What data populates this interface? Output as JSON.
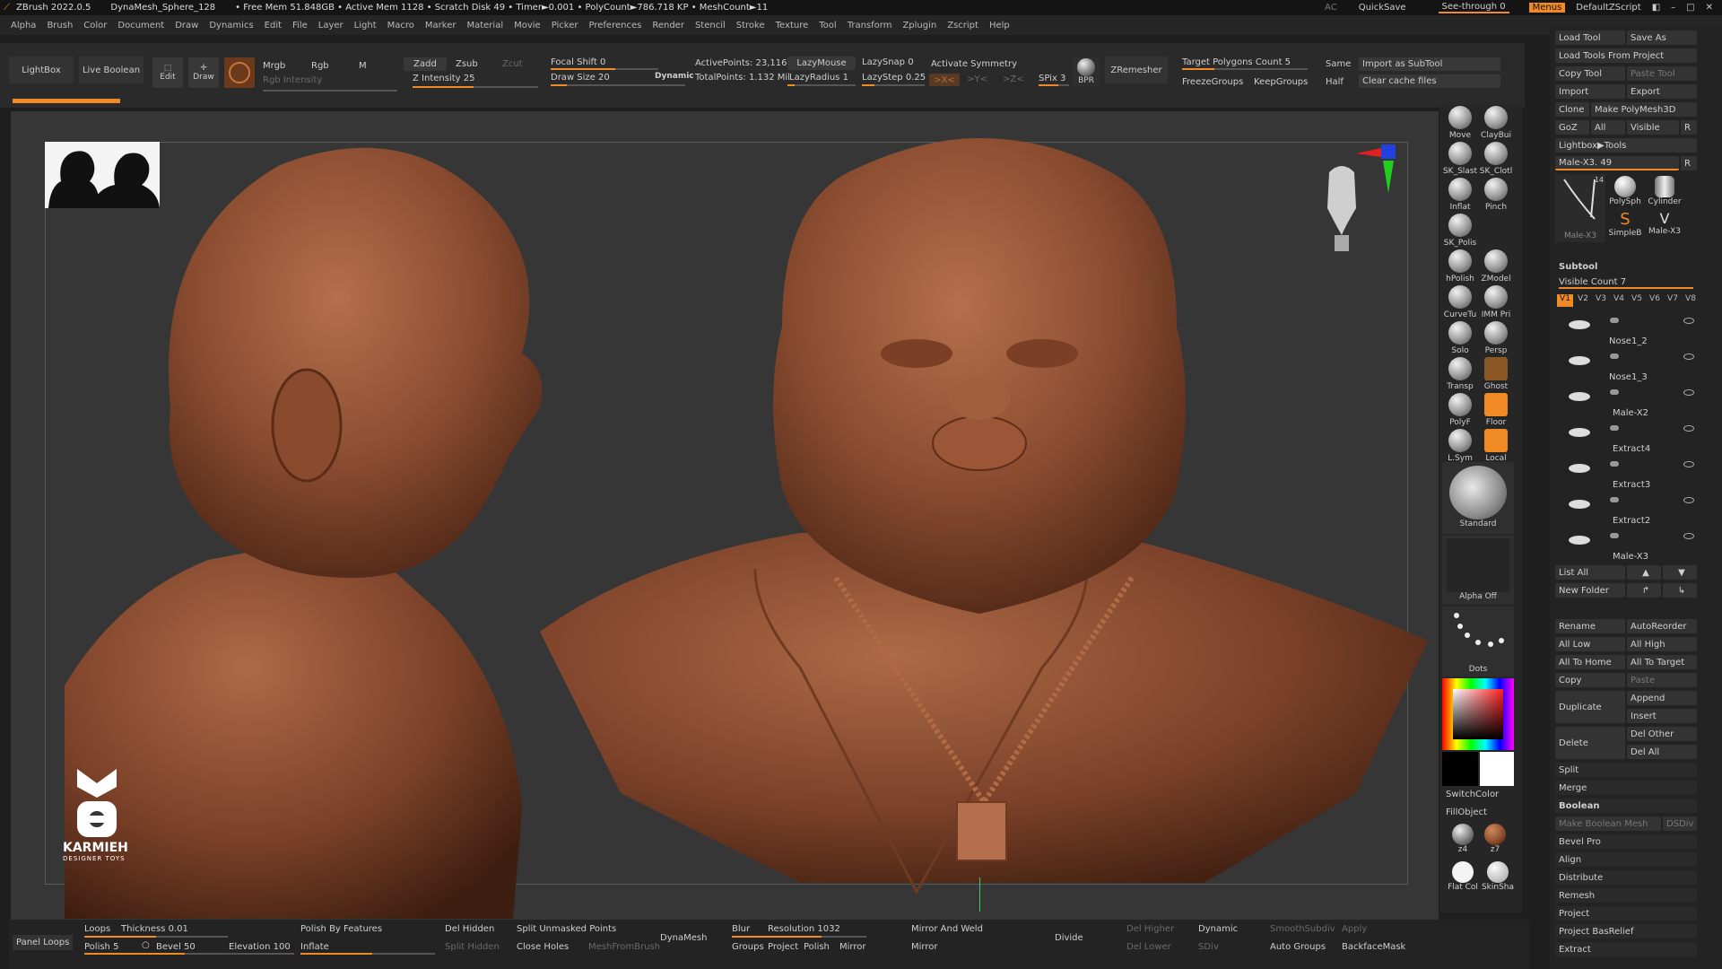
{
  "title_bar": {
    "app": "ZBrush 2022.0.5",
    "doc": "DynaMesh_Sphere_128",
    "stats": "• Free Mem 51.848GB • Active Mem 1128 • Scratch Disk 49 • Timer►0.001 • PolyCount►786.718 KP • MeshCount►11",
    "ac": "AC",
    "quicksave": "QuickSave",
    "see_through": "See-through  0",
    "menus": "Menus",
    "script": "DefaultZScript"
  },
  "menu": [
    "Alpha",
    "Brush",
    "Color",
    "Document",
    "Draw",
    "Dynamics",
    "Edit",
    "File",
    "Layer",
    "Light",
    "Macro",
    "Marker",
    "Material",
    "Movie",
    "Picker",
    "Preferences",
    "Render",
    "Stencil",
    "Stroke",
    "Texture",
    "Tool",
    "Transform",
    "Zplugin",
    "Zscript",
    "Help"
  ],
  "toolbar": {
    "lightbox": "LightBox",
    "live_boolean": "Live Boolean",
    "edit": "Edit",
    "draw": "Draw",
    "mrgb": "Mrgb",
    "rgb": "Rgb",
    "m": "M",
    "rgb_intensity": "Rgb Intensity",
    "zadd": "Zadd",
    "zsub": "Zsub",
    "zcut": "Zcut",
    "z_intensity": "Z Intensity 25",
    "focal_shift": "Focal Shift 0",
    "draw_size": "Draw Size 20",
    "dynamic": "Dynamic",
    "active_points": "ActivePoints: 23,116",
    "total_points": "TotalPoints: 1.132 Mil",
    "lazymouse": "LazyMouse",
    "lazyradius": "LazyRadius 1",
    "lazysnap": "LazySnap 0",
    "lazystep": "LazyStep 0.25",
    "activate_symmetry": "Activate Symmetry",
    "x": ">X<",
    "y": ">Y<",
    "z": ">Z<",
    "spix": "SPix 3",
    "bpr": "BPR",
    "zremesher": "ZRemesher",
    "target_polys": "Target Polygons Count 5",
    "same": "Same",
    "import_subtool": "Import as SubTool",
    "freezegroups": "FreezeGroups",
    "keepgroups": "KeepGroups",
    "half": "Half",
    "clear_cache": "Clear cache files"
  },
  "viewport": {
    "logo_text": "KARMIEH",
    "logo_sub": "DESIGNER TOYS"
  },
  "shelf": [
    {
      "label": "Move",
      "icon": "move-brush-icon"
    },
    {
      "label": "ClayBui",
      "icon": "claybuildup-brush-icon"
    },
    {
      "label": "SK_Slast",
      "icon": "sk-slash-brush-icon"
    },
    {
      "label": "SK_Clotl",
      "icon": "sk-cloth-brush-icon"
    },
    {
      "label": "Inflat",
      "icon": "inflate-brush-icon"
    },
    {
      "label": "Pinch",
      "icon": "pinch-brush-icon"
    },
    {
      "label": "SK_Polis",
      "icon": "sk-polish-brush-icon"
    },
    {
      "label": "hPolish",
      "icon": "hpolish-brush-icon"
    },
    {
      "label": "ZModel",
      "icon": "zmodeler-brush-icon"
    },
    {
      "label": "CurveTu",
      "icon": "curvetube-brush-icon"
    },
    {
      "label": "IMM Pri",
      "icon": "imm-primitives-brush-icon"
    },
    {
      "label": "Solo",
      "icon": "solo-icon"
    },
    {
      "label": "Persp",
      "icon": "perspective-icon"
    },
    {
      "label": "Transp",
      "icon": "transparency-icon"
    },
    {
      "label": "Ghost",
      "icon": "ghost-icon"
    },
    {
      "label": "PolyF",
      "icon": "polyframe-icon"
    },
    {
      "label": "Floor",
      "icon": "floor-icon"
    },
    {
      "label": "L.Sym",
      "icon": "local-symmetry-icon"
    },
    {
      "label": "Local",
      "icon": "local-transform-icon"
    }
  ],
  "shelf_lower": {
    "standard": "Standard",
    "alpha_off": "Alpha Off",
    "dots": "Dots",
    "switchcolor": "SwitchColor",
    "fillobject": "FillObject",
    "z4": "z4",
    "z7": "z7",
    "flat_col": "Flat Col",
    "skinsha": "SkinSha"
  },
  "right_panel": {
    "load_tool": "Load Tool",
    "save_as": "Save As",
    "load_from_project": "Load Tools From Project",
    "copy_tool": "Copy Tool",
    "paste_tool": "Paste Tool",
    "import": "Import",
    "export": "Export",
    "clone": "Clone",
    "make_polymesh": "Make PolyMesh3D",
    "goz": "GoZ",
    "all": "All",
    "visible": "Visible",
    "r": "R",
    "lightbox_tools": "Lightbox▶Tools",
    "current_tool": "Male-X3. 49",
    "tool_thumbs": [
      "Male-X3",
      "PolySph",
      "Cylinder",
      "SimpleB",
      "Male-X3"
    ],
    "thumb_count": "14",
    "subtool_header": "Subtool",
    "visible_count": "Visible Count 7",
    "versions": [
      "V1",
      "V2",
      "V3",
      "V4",
      "V5",
      "V6",
      "V7",
      "V8"
    ],
    "subtools": [
      "Nose1_2",
      "Nose1_3",
      "Male-X2",
      "Extract4",
      "Extract3",
      "Extract2",
      "Male-X3"
    ],
    "list_all": "List All",
    "new_folder": "New Folder",
    "rename": "Rename",
    "autoreorder": "AutoReorder",
    "all_low": "All Low",
    "all_high": "All High",
    "all_to_home": "All To Home",
    "all_to_target": "All To Target",
    "copy": "Copy",
    "paste": "Paste",
    "append": "Append",
    "duplicate": "Duplicate",
    "insert": "Insert",
    "del_other": "Del Other",
    "delete": "Delete",
    "del_all": "Del All",
    "split": "Split",
    "merge": "Merge",
    "boolean": "Boolean",
    "make_boolean_mesh": "Make Boolean Mesh",
    "dsdiv": "DSDiv",
    "bevel_pro": "Bevel Pro",
    "align": "Align",
    "distribute": "Distribute",
    "remesh": "Remesh",
    "project": "Project",
    "project_basrelief": "Project BasRelief",
    "extract": "Extract"
  },
  "bottom": {
    "panel_loops": "Panel Loops",
    "loops": "Loops",
    "thickness": "Thickness 0.01",
    "polish": "Polish 5",
    "bevel": "Bevel 50",
    "elevation": "Elevation 100",
    "polish_by_features": "Polish By Features",
    "inflate": "Inflate",
    "del_hidden": "Del Hidden",
    "split_hidden": "Split Hidden",
    "split_unmasked": "Split Unmasked Points",
    "close_holes": "Close Holes",
    "meshfrombrush": "MeshFromBrush",
    "dynamesh": "DynaMesh",
    "blur": "Blur",
    "resolution": "Resolution 1032",
    "groups": "Groups",
    "project": "Project",
    "polish2": "Polish",
    "mirror": "Mirror",
    "mirror_and_weld": "Mirror And Weld",
    "mirror2": "Mirror",
    "divide": "Divide",
    "del_higher": "Del Higher",
    "del_lower": "Del Lower",
    "dynamic": "Dynamic",
    "smoothsubdiv": "SmoothSubdiv",
    "apply": "Apply",
    "sdiv": "SDiv",
    "auto_groups": "Auto Groups",
    "backfacemask": "BackfaceMask"
  }
}
